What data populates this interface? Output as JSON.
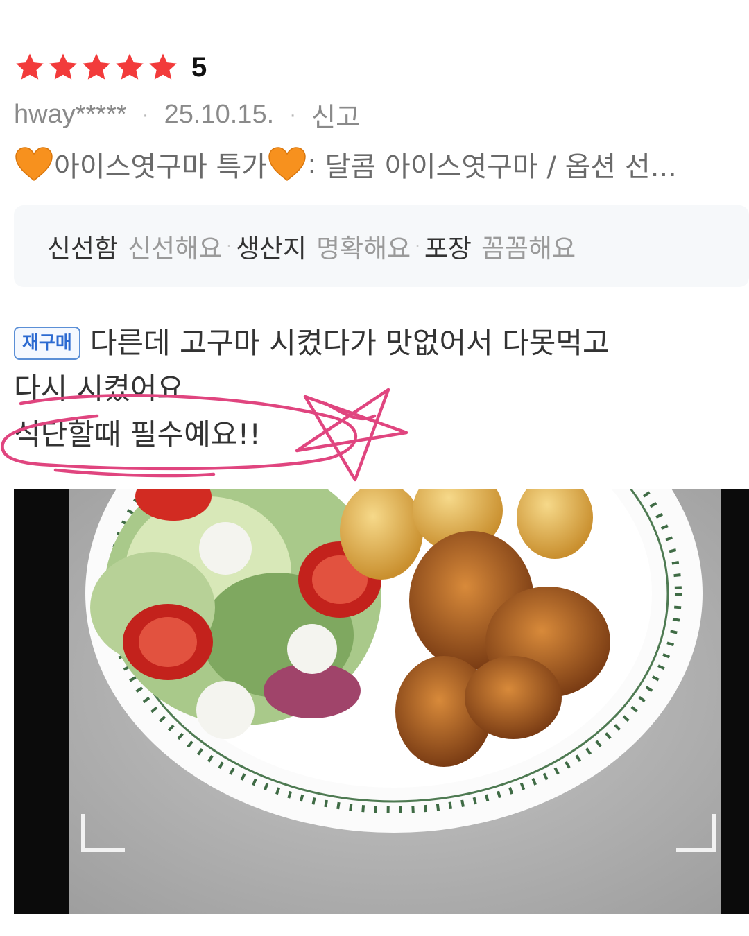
{
  "rating": {
    "stars_filled": 5,
    "stars_total": 5,
    "score_label": "5",
    "star_color": "#f23b3b"
  },
  "meta": {
    "user": "hway*****",
    "date": "25.10.15.",
    "report_label": "신고"
  },
  "option": {
    "title": "아이스엿구마 특가",
    "separator": ":",
    "detail": "달콤 아이스엿구마 / 옵션 선..."
  },
  "evaluations": [
    {
      "key": "신선함",
      "value": "신선해요"
    },
    {
      "key": "생산지",
      "value": "명확해요"
    },
    {
      "key": "포장",
      "value": "꼼꼼해요"
    }
  ],
  "review": {
    "badge": "재구매",
    "line1": "다른데 고구마 시켰다가 맛없어서 다못먹고",
    "line2": "다시 시켰어요",
    "line3": "식단할때 필수예요!!",
    "highlight_color": "#e0457f"
  },
  "photo": {
    "subject": "salad-chicken-plate"
  }
}
